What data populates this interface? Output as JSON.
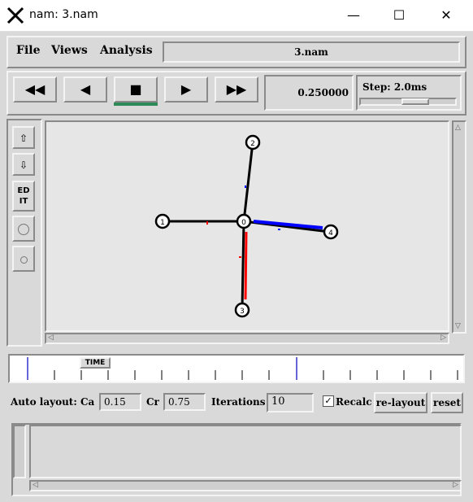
{
  "window": {
    "title": "nam: 3.nam",
    "minimize": "—",
    "maximize": "☐",
    "close": "✕"
  },
  "menu": {
    "file": "File",
    "views": "Views",
    "analysis": "Analysis",
    "filename": "3.nam"
  },
  "playback": {
    "rewind": "◀◀",
    "back": "◀",
    "stop": "■",
    "play": "▶",
    "fastforward": "▶▶"
  },
  "time_value": "0.250000",
  "step": {
    "label": "Step: 2.0ms"
  },
  "side": {
    "zoom_in": "⇧",
    "zoom_out": "⇩",
    "edit": "ED\nIT"
  },
  "timeline": {
    "marker_label": "TIME"
  },
  "layout": {
    "auto_label": "Auto layout:",
    "ca_label": "Ca",
    "ca_value": "0.15",
    "cr_label": "Cr",
    "cr_value": "0.75",
    "iter_label": "Iterations",
    "iter_value": "10",
    "recalc_label": "Recalc",
    "relayout_label": "re-layout",
    "reset_label": "reset"
  },
  "graph": {
    "nodes": [
      {
        "id": "0"
      },
      {
        "id": "1"
      },
      {
        "id": "2"
      },
      {
        "id": "3"
      },
      {
        "id": "4"
      }
    ]
  },
  "colors": {
    "link": "#000000",
    "red_packet": "#ff0000",
    "blue_packet": "#0000ff",
    "progress": "#2e8b57"
  }
}
